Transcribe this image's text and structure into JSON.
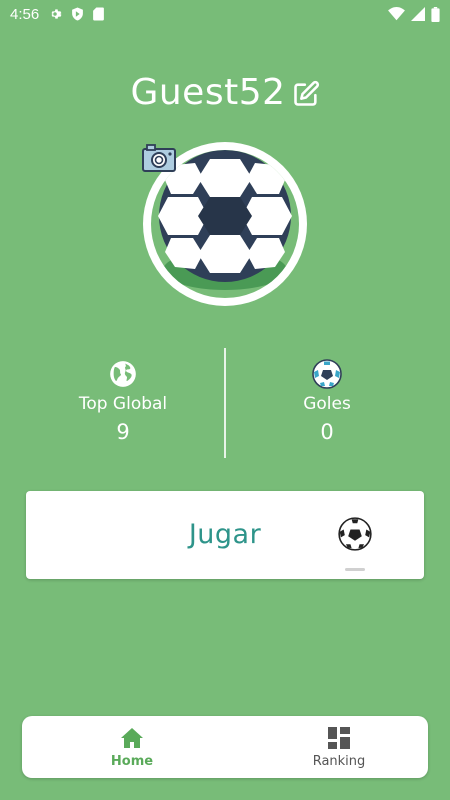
{
  "status_bar": {
    "time": "4:56"
  },
  "profile": {
    "username": "Guest52"
  },
  "stats": {
    "top_global": {
      "label": "Top Global",
      "value": "9"
    },
    "goals": {
      "label": "Goles",
      "value": "0"
    }
  },
  "play": {
    "label": "Jugar"
  },
  "nav": {
    "home_label": "Home",
    "ranking_label": "Ranking"
  },
  "colors": {
    "background": "#78bc78",
    "accent": "#2e948a",
    "nav_active": "#5aaa5a"
  }
}
